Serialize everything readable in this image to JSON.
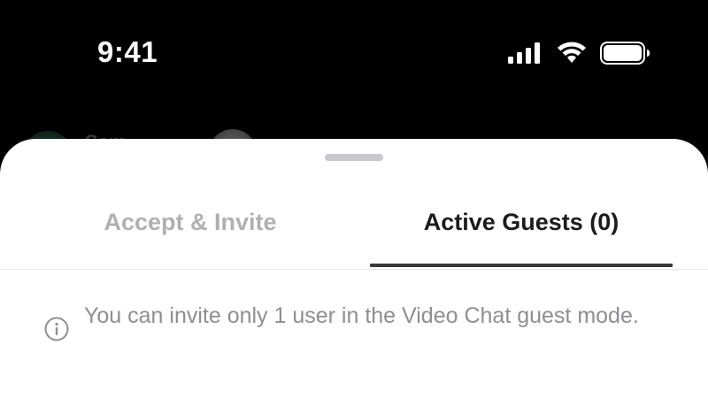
{
  "status_bar": {
    "time": "9:41",
    "signal_icon": "cellular-signal-icon",
    "wifi_icon": "wifi-icon",
    "battery_icon": "battery-icon"
  },
  "background": {
    "peek_name": "Sam"
  },
  "sheet": {
    "tabs": [
      {
        "label": "Accept & Invite",
        "selected": false
      },
      {
        "label": "Active Guests (0)",
        "selected": true
      }
    ],
    "info": {
      "icon": "info-icon",
      "text": "You can invite only 1 user in the Video Chat guest mode."
    }
  },
  "colors": {
    "background": "#000000",
    "sheet": "#ffffff",
    "tab_inactive": "#b0b0b0",
    "tab_active": "#1c1c1e",
    "info_text": "#8e8e93"
  }
}
